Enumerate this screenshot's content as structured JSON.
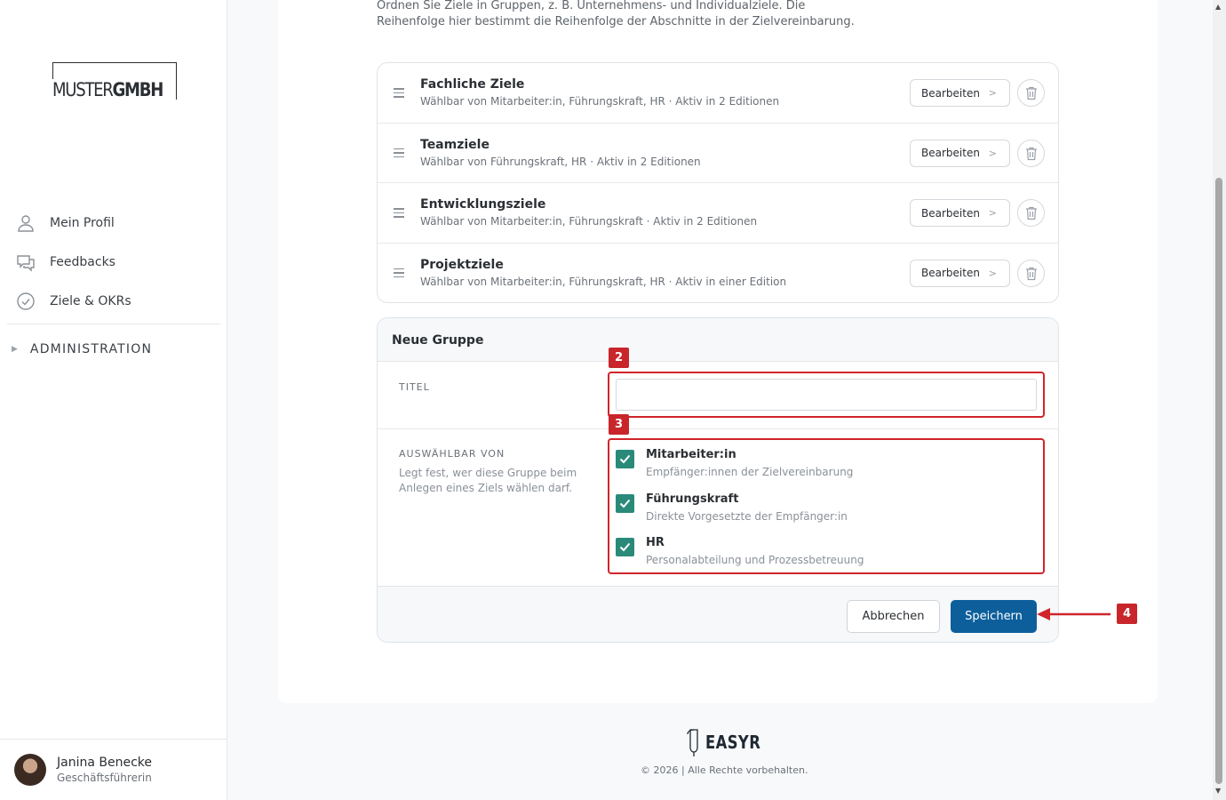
{
  "sidebar": {
    "logo": {
      "part1": "MUSTER",
      "part2": "GMBH"
    },
    "nav": [
      {
        "label": "Mein Profil",
        "icon": "user-icon"
      },
      {
        "label": "Feedbacks",
        "icon": "chat-icon"
      },
      {
        "label": "Ziele & OKRs",
        "icon": "check-circle-icon"
      }
    ],
    "admin_label": "ADMINISTRATION",
    "user": {
      "name": "Janina Benecke",
      "role": "Geschäftsführerin"
    }
  },
  "main": {
    "intro": "Ordnen Sie Ziele in Gruppen, z. B. Unternehmens- und Individualziele. Die Reihenfolge hier bestimmt die Reihenfolge der Abschnitte in der Zielvereinbarung.",
    "groups": [
      {
        "title": "Fachliche Ziele",
        "subtitle": "Wählbar von Mitarbeiter:in, Führungskraft, HR · Aktiv in 2 Editionen"
      },
      {
        "title": "Teamziele",
        "subtitle": "Wählbar von Führungskraft, HR · Aktiv in 2 Editionen"
      },
      {
        "title": "Entwicklungsziele",
        "subtitle": "Wählbar von Mitarbeiter:in, Führungskraft · Aktiv in 2 Editionen"
      },
      {
        "title": "Projektziele",
        "subtitle": "Wählbar von Mitarbeiter:in, Führungskraft, HR · Aktiv in einer Edition"
      }
    ],
    "edit_label": "Bearbeiten",
    "new_group": {
      "heading": "Neue Gruppe",
      "title_label": "TITEL",
      "title_value": "",
      "selectable_label": "AUSWÄHLBAR VON",
      "selectable_desc": "Legt fest, wer diese Gruppe beim Anlegen eines Ziels wählen darf.",
      "options": [
        {
          "title": "Mitarbeiter:in",
          "subtitle": "Empfänger:innen der Zielvereinbarung",
          "checked": true
        },
        {
          "title": "Führungskraft",
          "subtitle": "Direkte Vorgesetzte der Empfänger:in",
          "checked": true
        },
        {
          "title": "HR",
          "subtitle": "Personalabteilung und Prozessbetreuung",
          "checked": true
        }
      ],
      "cancel_label": "Abbrechen",
      "save_label": "Speichern"
    }
  },
  "annotations": {
    "badge2": "2",
    "badge3": "3",
    "badge4": "4",
    "color": "#d0252a"
  },
  "footer": {
    "brand": "EASYR",
    "copyright": "© 2026 | Alle Rechte vorbehalten."
  },
  "colors": {
    "primary": "#0d5f9c",
    "checkbox": "#2a8a7a"
  }
}
